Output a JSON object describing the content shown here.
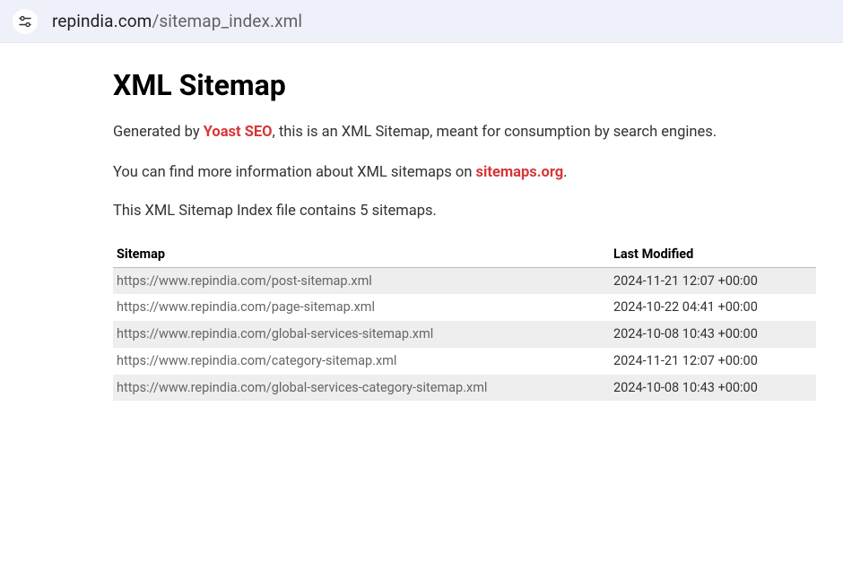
{
  "urlbar": {
    "domain": "repindia.com",
    "path": "/sitemap_index.xml"
  },
  "page": {
    "title": "XML Sitemap",
    "intro_prefix": "Generated by ",
    "yoast_label": "Yoast SEO",
    "intro_suffix": ", this is an XML Sitemap, meant for consumption by search engines.",
    "more_prefix": "You can find more information about XML sitemaps on ",
    "sitemaps_org_label": "sitemaps.org",
    "more_suffix": ".",
    "count_line": "This XML Sitemap Index file contains 5 sitemaps."
  },
  "table": {
    "headers": {
      "sitemap": "Sitemap",
      "modified": "Last Modified"
    },
    "rows": [
      {
        "url": "https://www.repindia.com/post-sitemap.xml",
        "modified": "2024-11-21 12:07 +00:00"
      },
      {
        "url": "https://www.repindia.com/page-sitemap.xml",
        "modified": "2024-10-22 04:41 +00:00"
      },
      {
        "url": "https://www.repindia.com/global-services-sitemap.xml",
        "modified": "2024-10-08 10:43 +00:00"
      },
      {
        "url": "https://www.repindia.com/category-sitemap.xml",
        "modified": "2024-11-21 12:07 +00:00"
      },
      {
        "url": "https://www.repindia.com/global-services-category-sitemap.xml",
        "modified": "2024-10-08 10:43 +00:00"
      }
    ]
  }
}
